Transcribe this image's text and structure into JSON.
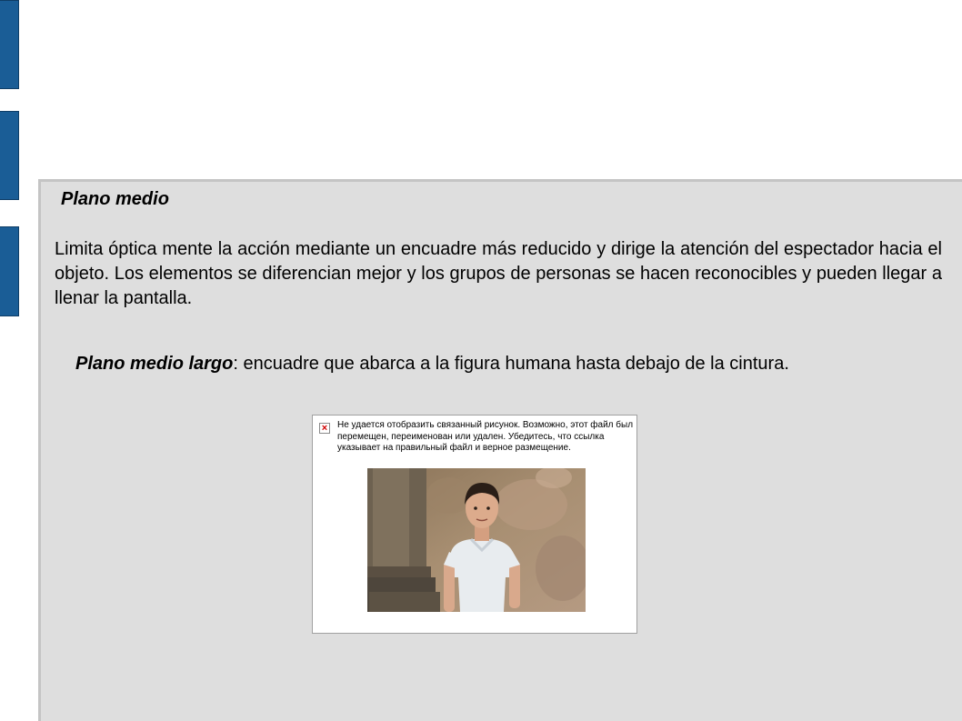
{
  "slide": {
    "heading": "Plano medio",
    "paragraph": "Limita óptica mente la acción mediante un encuadre más reducido y dirige la atención del espectador hacia el objeto. Los elementos se diferencian mejor y los grupos de personas se hacen reconocibles y pueden llegar a llenar la pantalla.",
    "definition_term": "Plano medio largo",
    "definition_text": ": encuadre que abarca a la figura humana hasta debajo de la cintura."
  },
  "image_placeholder": {
    "message": "Не удается отобразить связанный рисунок. Возможно, этот файл был перемещен, переименован или удален. Убедитесь, что ссылка указывает на правильный файл и верное размещение.",
    "icon": "broken-image-icon"
  },
  "colors": {
    "side_tab": "#1a5d96",
    "content_bg": "#dedede"
  }
}
